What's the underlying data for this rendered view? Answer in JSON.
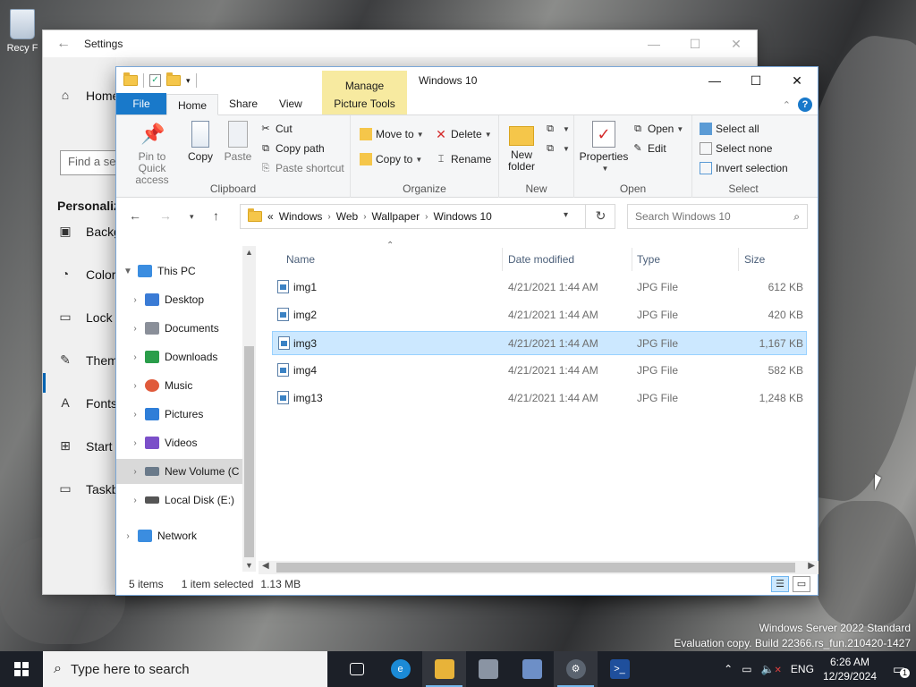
{
  "desktop": {
    "recycle_bin_label": "Recy",
    "edge_label": "F"
  },
  "settings": {
    "title": "Settings",
    "home": "Home",
    "find_placeholder": "Find a se",
    "section": "Personaliz",
    "items": [
      "Backg",
      "Color",
      "Lock s",
      "Them",
      "Fonts",
      "Start",
      "Taskb"
    ]
  },
  "explorer": {
    "ribbon_context": "Manage",
    "window_title": "Windows 10",
    "tabs": {
      "file": "File",
      "home": "Home",
      "share": "Share",
      "view": "View",
      "picture_tools": "Picture Tools"
    },
    "help": "?",
    "ribbon": {
      "clipboard": {
        "label": "Clipboard",
        "pin_line1": "Pin to Quick",
        "pin_line2": "access",
        "copy": "Copy",
        "paste": "Paste",
        "cut": "Cut",
        "copy_path": "Copy path",
        "paste_shortcut": "Paste shortcut"
      },
      "organize": {
        "label": "Organize",
        "move_to": "Move to",
        "copy_to": "Copy to",
        "delete": "Delete",
        "rename": "Rename"
      },
      "new": {
        "label": "New",
        "new_folder_line1": "New",
        "new_folder_line2": "folder"
      },
      "open": {
        "label": "Open",
        "properties": "Properties",
        "open": "Open",
        "edit": "Edit"
      },
      "select": {
        "label": "Select",
        "select_all": "Select all",
        "select_none": "Select none",
        "invert": "Invert selection"
      }
    },
    "address": {
      "overflow": "«",
      "crumbs": [
        "Windows",
        "Web",
        "Wallpaper",
        "Windows 10"
      ],
      "search_placeholder": "Search Windows 10"
    },
    "tree": [
      {
        "label": "This PC",
        "icon_color": "#3b8de0"
      },
      {
        "label": "Desktop",
        "icon_color": "#3a7bd5"
      },
      {
        "label": "Documents",
        "icon_color": "#8a8f99"
      },
      {
        "label": "Downloads",
        "icon_color": "#2a9d4a"
      },
      {
        "label": "Music",
        "icon_color": "#e05a3b"
      },
      {
        "label": "Pictures",
        "icon_color": "#2f7ed8"
      },
      {
        "label": "Videos",
        "icon_color": "#7b4fc9"
      },
      {
        "label": "New Volume (C",
        "icon_color": "#6a7a8a"
      },
      {
        "label": "Local Disk (E:)",
        "icon_color": "#555555"
      },
      {
        "label": "Network",
        "icon_color": "#3b8de0"
      }
    ],
    "columns": {
      "name": "Name",
      "date": "Date modified",
      "type": "Type",
      "size": "Size"
    },
    "files": [
      {
        "name": "img1",
        "date": "4/21/2021 1:44 AM",
        "type": "JPG File",
        "size": "612 KB"
      },
      {
        "name": "img2",
        "date": "4/21/2021 1:44 AM",
        "type": "JPG File",
        "size": "420 KB"
      },
      {
        "name": "img3",
        "date": "4/21/2021 1:44 AM",
        "type": "JPG File",
        "size": "1,167 KB"
      },
      {
        "name": "img4",
        "date": "4/21/2021 1:44 AM",
        "type": "JPG File",
        "size": "582 KB"
      },
      {
        "name": "img13",
        "date": "4/21/2021 1:44 AM",
        "type": "JPG File",
        "size": "1,248 KB"
      }
    ],
    "selected_file": "img3",
    "status": {
      "items": "5 items",
      "selected": "1 item selected",
      "size": "1.13 MB"
    }
  },
  "watermark": {
    "line1": "Windows Server 2022 Standard",
    "line2": "Evaluation copy. Build 22366.rs_fun.210420-1427"
  },
  "taskbar": {
    "search_placeholder": "Type here to search",
    "apps": [
      {
        "name": "task-view",
        "color": "#1c2028",
        "glyph": "▯"
      },
      {
        "name": "edge",
        "color": "#1b8ad6",
        "glyph": "e"
      },
      {
        "name": "file-explorer",
        "color": "#e8b339",
        "glyph": "▬"
      },
      {
        "name": "server-manager",
        "color": "#8a94a3",
        "glyph": "▤"
      },
      {
        "name": "notepad",
        "color": "#6d8fc7",
        "glyph": "≡"
      },
      {
        "name": "settings",
        "color": "#5b6470",
        "glyph": "⚙"
      },
      {
        "name": "powershell",
        "color": "#1f4f9c",
        "glyph": ">_"
      }
    ],
    "language": "ENG",
    "time": "6:26 AM",
    "date": "12/29/2024",
    "notification_count": "1"
  },
  "colors": {
    "accent": "#1979ca",
    "selection": "#cce8ff",
    "manage_tab": "#f7eaa0"
  }
}
